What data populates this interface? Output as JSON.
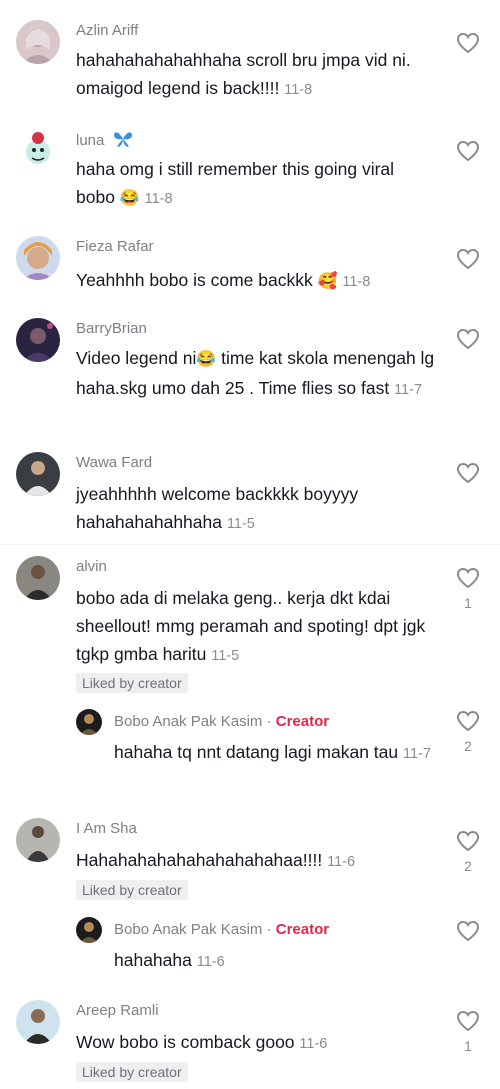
{
  "comments": [
    {
      "user": "Azlin Ariff",
      "text": "hahahahahahahhaha scroll bru jmpa vid ni. omaigod legend is back!!!!",
      "date": "11-8"
    },
    {
      "user": "luna",
      "text": "haha omg i still remember this going viral bobo",
      "emoji": "😂",
      "date": "11-8"
    },
    {
      "user": "Fieza Rafar",
      "text": "Yeahhhh bobo is come backkk",
      "emoji": "🥰",
      "date": "11-8"
    },
    {
      "user": "BarryBrian",
      "text_a": "Video legend ni",
      "emoji": "😂",
      "text_b": " time kat skola menengah lg haha.skg umo dah 25 . Time flies so fast",
      "date": "11-7"
    },
    {
      "user": "Wawa Fard",
      "text": "jyeahhhhh welcome backkkk boyyyy hahahahahahhaha",
      "date": "11-5"
    },
    {
      "user": "alvin",
      "text": "bobo ada di melaka geng.. kerja dkt kdai sheellout! mmg peramah and spoting! dpt jgk tgkp gmba haritu",
      "date": "11-5",
      "badge": "Liked by creator",
      "likes": "1"
    },
    {
      "user": "Bobo Anak Pak Kasim",
      "separator": " · ",
      "creator_label": "Creator",
      "text": "hahaha tq nnt datang lagi makan tau",
      "date": "11-7",
      "likes": "2"
    },
    {
      "user": "I Am Sha",
      "text": "Hahahahahahahahahahahaa!!!!",
      "date": "11-6",
      "badge": "Liked by creator",
      "likes": "2"
    },
    {
      "user": "Bobo Anak Pak Kasim",
      "separator": " · ",
      "creator_label": "Creator",
      "text": "hahahaha",
      "date": "11-6"
    },
    {
      "user": "Areep Ramli",
      "text": "Wow bobo is comback gooo",
      "date": "11-6",
      "badge": "Liked by creator",
      "likes": "1"
    }
  ],
  "colors": {
    "creator": "#e0284d",
    "muted": "#8a8b91",
    "text": "#161823"
  },
  "icons": {
    "like": "heart-outline-icon",
    "luna_badge": "butterfly-icon"
  }
}
